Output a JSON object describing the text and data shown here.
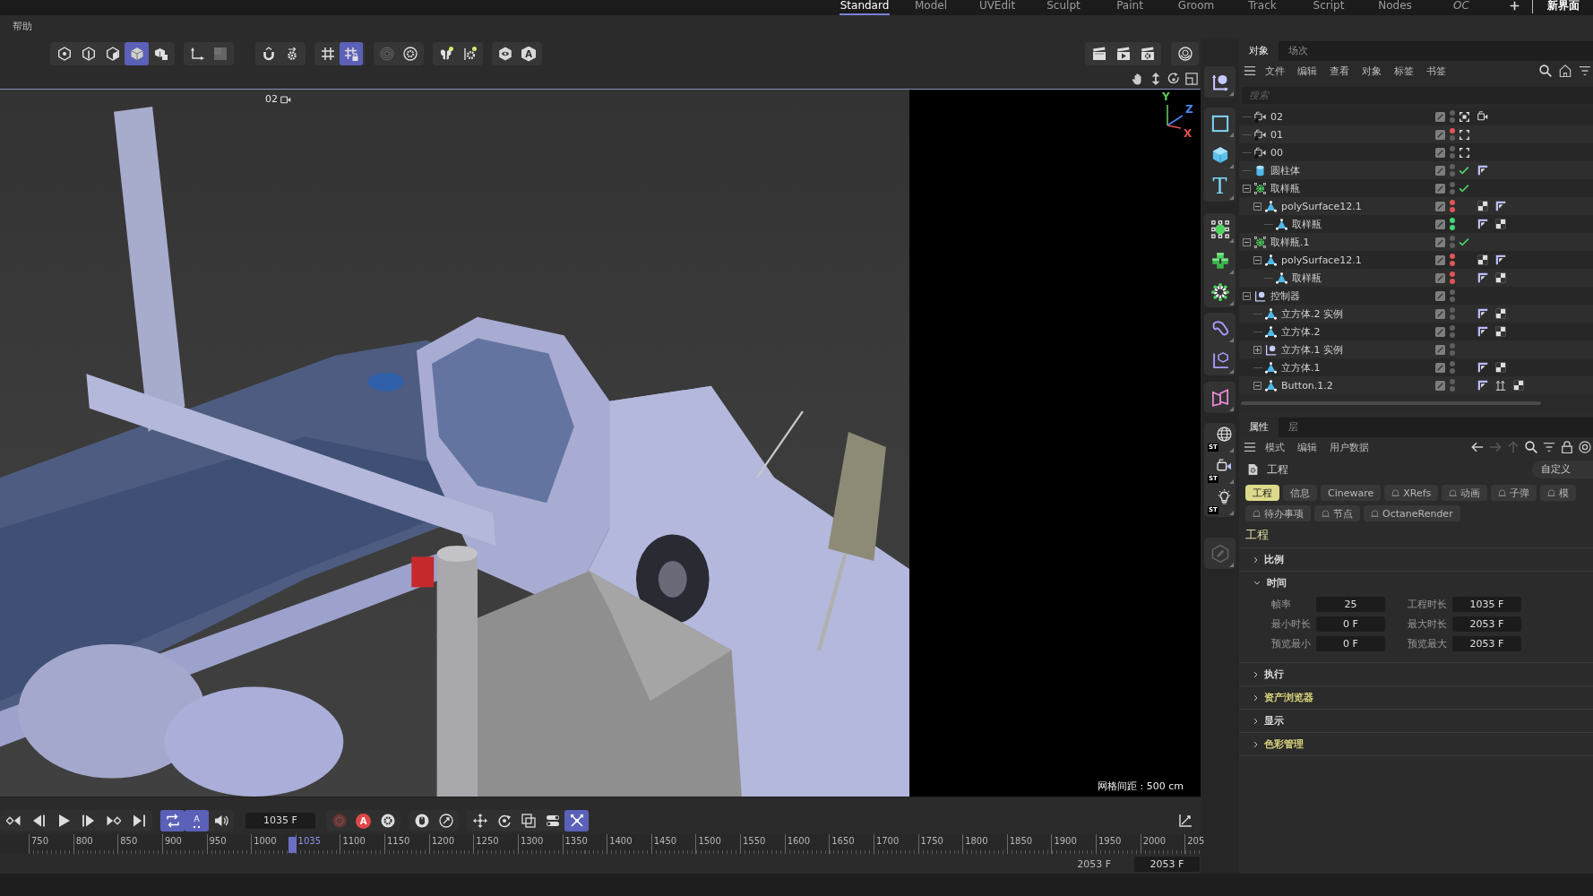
{
  "top_bar": {
    "layouts": [
      {
        "label": "Standard",
        "kind": "layout",
        "selected": true
      },
      {
        "label": "Model",
        "kind": "layout",
        "selected": false
      },
      {
        "label": "UVEdit",
        "kind": "layout",
        "selected": false
      },
      {
        "label": "Sculpt",
        "kind": "layout",
        "selected": false
      },
      {
        "label": "Paint",
        "kind": "layout",
        "selected": false
      },
      {
        "label": "Groom",
        "kind": "layout",
        "selected": false
      },
      {
        "label": "Track",
        "kind": "layout",
        "selected": false
      },
      {
        "label": "Script",
        "kind": "layout",
        "selected": false
      },
      {
        "label": "Nodes",
        "kind": "layout",
        "selected": false
      },
      {
        "label": "OC",
        "kind": "plugin",
        "selected": false
      }
    ],
    "new_layout": "新界面"
  },
  "menu_bar": [
    "帮助"
  ],
  "mode_toolbar": {
    "groups": [
      {
        "tools": [
          {
            "kind": "points",
            "selected": false,
            "disabled": false
          },
          {
            "kind": "edges",
            "selected": false,
            "disabled": false
          },
          {
            "kind": "polygons",
            "selected": false,
            "disabled": false
          },
          {
            "kind": "model",
            "selected": true,
            "disabled": false
          },
          {
            "kind": "uvw",
            "selected": false,
            "disabled": false
          }
        ]
      },
      {
        "tools": [
          {
            "kind": "axis",
            "selected": false,
            "disabled": false
          },
          {
            "kind": "solo",
            "selected": false,
            "disabled": true
          }
        ]
      },
      {
        "tools": [
          {
            "kind": "snap",
            "selected": false,
            "disabled": false
          },
          {
            "kind": "snap-settings",
            "selected": false,
            "disabled": false
          }
        ]
      },
      {
        "tools": [
          {
            "kind": "grid",
            "selected": false,
            "disabled": false
          },
          {
            "kind": "grid-lock",
            "selected": true,
            "disabled": false
          }
        ]
      },
      {
        "tools": [
          {
            "kind": "soft-select",
            "selected": false,
            "disabled": true
          },
          {
            "kind": "settings",
            "selected": false,
            "disabled": false
          }
        ]
      },
      {
        "tools": [
          {
            "kind": "symmetry",
            "selected": false,
            "disabled": false
          },
          {
            "kind": "symmetry-settings",
            "selected": false,
            "disabled": false
          }
        ]
      },
      {
        "tools": [
          {
            "kind": "view",
            "selected": false,
            "disabled": false
          },
          {
            "kind": "hex-label",
            "label": "A",
            "selected": false,
            "disabled": false
          }
        ]
      }
    ]
  },
  "viewport": {
    "camera_label": "02",
    "axes": [
      {
        "label": "Y",
        "color": "#5cc85c"
      },
      {
        "label": "Z",
        "color": "#4d86f0"
      },
      {
        "label": "X",
        "color": "#e25050"
      }
    ],
    "grid_spacing": "网格间距 : 500 cm"
  },
  "side_toolbar": {
    "groups": [
      {
        "tools": [
          {
            "kind": "null",
            "disabled": false
          }
        ]
      },
      {
        "tools": [
          {
            "kind": "spline-square",
            "disabled": false
          },
          {
            "kind": "cube",
            "disabled": false
          },
          {
            "kind": "text",
            "label": "T",
            "disabled": false
          }
        ]
      },
      {
        "tools": [
          {
            "kind": "generator",
            "disabled": false
          },
          {
            "kind": "cloner",
            "disabled": false
          },
          {
            "kind": "effector",
            "disabled": false
          }
        ]
      },
      {
        "tools": [
          {
            "kind": "deformer",
            "disabled": false
          },
          {
            "kind": "field",
            "disabled": false
          }
        ]
      },
      {
        "tools": [
          {
            "kind": "symmetry",
            "disabled": false
          }
        ]
      },
      {
        "tools": [
          {
            "kind": "globe",
            "badge": "ST",
            "disabled": false
          },
          {
            "kind": "camera",
            "badge": "ST",
            "disabled": false
          },
          {
            "kind": "light",
            "badge": "ST",
            "disabled": false
          }
        ]
      },
      {
        "tools": [
          {
            "kind": "pencil",
            "disabled": true
          }
        ]
      }
    ]
  },
  "object_manager": {
    "tabs": [
      {
        "label": "对象",
        "selected": true
      },
      {
        "label": "场次",
        "selected": false
      }
    ],
    "menu": [
      "文件",
      "编辑",
      "查看",
      "对象",
      "标签",
      "书签"
    ],
    "search": {
      "placeholder": "搜索"
    },
    "objects": [
      {
        "name": "02",
        "kind": "camera",
        "visibility": [
          {
            "color": "#5e5e5e"
          },
          {
            "color": "#5e5e5e"
          }
        ],
        "active": true,
        "tags": [
          {
            "kind": "camera"
          }
        ]
      },
      {
        "name": "01",
        "kind": "camera",
        "visibility": [
          {
            "color": "#e25555"
          },
          {
            "color": "#5e5e5e"
          }
        ],
        "active": false
      },
      {
        "name": "00",
        "kind": "camera",
        "visibility": [
          {
            "color": "#5e5e5e"
          },
          {
            "color": "#5e5e5e"
          }
        ],
        "active": false
      },
      {
        "name": "圆柱体",
        "kind": "cylinder",
        "visibility": [
          {
            "color": "#5e5e5e"
          },
          {
            "color": "#5e5e5e"
          }
        ],
        "enabled": true,
        "tags": [
          {
            "kind": "phong"
          }
        ]
      },
      {
        "name": "取样瓶",
        "kind": "cloner",
        "visibility": [
          {
            "color": "#5e5e5e"
          },
          {
            "color": "#5e5e5e"
          }
        ],
        "enabled": true,
        "expanded": true,
        "children": [
          {
            "name": "polySurface12.1",
            "kind": "polygon",
            "visibility": [
              {
                "color": "#e25555"
              },
              {
                "color": "#e25555"
              }
            ],
            "expanded": true,
            "tags": [
              {
                "kind": "material"
              },
              {
                "kind": "phong"
              }
            ],
            "children": [
              {
                "name": "取样瓶",
                "kind": "polygon",
                "visibility": [
                  {
                    "color": "#45d87a"
                  },
                  {
                    "color": "#45d87a"
                  }
                ],
                "tags": [
                  {
                    "kind": "phong"
                  },
                  {
                    "kind": "material"
                  }
                ]
              }
            ]
          }
        ]
      },
      {
        "name": "取样瓶.1",
        "kind": "cloner",
        "visibility": [
          {
            "color": "#5e5e5e"
          },
          {
            "color": "#5e5e5e"
          }
        ],
        "enabled": true,
        "expanded": true,
        "children": [
          {
            "name": "polySurface12.1",
            "kind": "polygon",
            "visibility": [
              {
                "color": "#e25555"
              },
              {
                "color": "#e25555"
              }
            ],
            "expanded": true,
            "tags": [
              {
                "kind": "material"
              },
              {
                "kind": "phong"
              }
            ],
            "children": [
              {
                "name": "取样瓶",
                "kind": "polygon",
                "visibility": [
                  {
                    "color": "#e25555"
                  },
                  {
                    "color": "#e25555"
                  }
                ],
                "tags": [
                  {
                    "kind": "phong"
                  },
                  {
                    "kind": "material"
                  }
                ]
              }
            ]
          }
        ]
      },
      {
        "name": "控制器",
        "kind": "null",
        "visibility": [
          {
            "color": "#5e5e5e"
          },
          {
            "color": "#5e5e5e"
          }
        ],
        "expanded": true,
        "children": [
          {
            "name": "立方体.2 实例",
            "kind": "polygon",
            "visibility": [
              {
                "color": "#5e5e5e"
              },
              {
                "color": "#5e5e5e"
              }
            ],
            "tags": [
              {
                "kind": "phong"
              },
              {
                "kind": "material"
              }
            ]
          },
          {
            "name": "立方体.2",
            "kind": "polygon",
            "visibility": [
              {
                "color": "#5e5e5e"
              },
              {
                "color": "#5e5e5e"
              }
            ],
            "tags": [
              {
                "kind": "phong"
              },
              {
                "kind": "material"
              }
            ]
          },
          {
            "name": "立方体.1 实例",
            "kind": "null",
            "visibility": [
              {
                "color": "#5e5e5e"
              },
              {
                "color": "#5e5e5e"
              }
            ],
            "expanded": false
          },
          {
            "name": "立方体.1",
            "kind": "polygon",
            "visibility": [
              {
                "color": "#5e5e5e"
              },
              {
                "color": "#5e5e5e"
              }
            ],
            "tags": [
              {
                "kind": "phong"
              },
              {
                "kind": "material"
              }
            ]
          },
          {
            "name": "Button.1.2",
            "kind": "polygon",
            "visibility": [
              {
                "color": "#5e5e5e"
              },
              {
                "color": "#5e5e5e"
              }
            ],
            "expanded": true,
            "tags": [
              {
                "kind": "phong"
              },
              {
                "kind": "constraint"
              },
              {
                "kind": "material"
              }
            ]
          }
        ]
      }
    ]
  },
  "attributes": {
    "tabs": [
      {
        "label": "属性",
        "selected": true
      },
      {
        "label": "层",
        "selected": false
      }
    ],
    "menu": [
      "模式",
      "编辑",
      "用户数据"
    ],
    "title": "工程",
    "preset": "自定义",
    "page_rows": [
      [
        {
          "label": "工程",
          "selected": true,
          "bell": false
        },
        {
          "label": "信息",
          "selected": false,
          "bell": false
        },
        {
          "label": "Cineware",
          "selected": false,
          "bell": false
        },
        {
          "label": "XRefs",
          "selected": false,
          "bell": true
        },
        {
          "label": "动画",
          "selected": false,
          "bell": true
        },
        {
          "label": "子弹",
          "selected": false,
          "bell": true
        },
        {
          "label": "模",
          "selected": false,
          "bell": true
        }
      ],
      [
        {
          "label": "待办事项",
          "selected": false,
          "bell": true
        },
        {
          "label": "节点",
          "selected": false,
          "bell": true
        },
        {
          "label": "OctaneRender",
          "selected": false,
          "bell": true
        }
      ]
    ],
    "section": "工程",
    "groups": [
      {
        "label": "比例",
        "expanded": false,
        "modified": false
      },
      {
        "label": "时间",
        "expanded": true,
        "modified": false,
        "fields": [
          {
            "label": "帧率",
            "value": "25"
          },
          {
            "label": "工程时长",
            "value": "1035 F"
          },
          {
            "label": "最小时长",
            "value": "0 F"
          },
          {
            "label": "最大时长",
            "value": "2053 F"
          },
          {
            "label": "预览最小",
            "value": "0 F"
          },
          {
            "label": "预览最大",
            "value": "2053 F"
          }
        ]
      },
      {
        "label": "执行",
        "expanded": false,
        "modified": false
      },
      {
        "label": "资产浏览器",
        "expanded": false,
        "modified": true
      },
      {
        "label": "显示",
        "expanded": false,
        "modified": false
      },
      {
        "label": "色彩管理",
        "expanded": false,
        "modified": true
      }
    ]
  },
  "timeline": {
    "left_groups": [
      {
        "tools": [
          {
            "kind": "prev-key",
            "selected": false,
            "disabled": false
          },
          {
            "kind": "prev-frame",
            "selected": false,
            "disabled": false
          },
          {
            "kind": "play",
            "selected": false,
            "disabled": false
          },
          {
            "kind": "next-frame",
            "selected": false,
            "disabled": false
          },
          {
            "kind": "next-key",
            "selected": false,
            "disabled": false
          },
          {
            "kind": "to-end",
            "selected": false,
            "disabled": false
          }
        ]
      },
      {
        "tools": [
          {
            "kind": "loop",
            "selected": true,
            "disabled": false
          },
          {
            "kind": "keys-track",
            "label": "A",
            "selected": true,
            "disabled": false
          },
          {
            "kind": "sound",
            "selected": false,
            "disabled": false
          }
        ]
      }
    ],
    "frame": "1035 F",
    "right_groups": [
      {
        "tools": [
          {
            "kind": "record",
            "selected": false,
            "disabled": true
          },
          {
            "kind": "autokey",
            "label": "A",
            "selected": false,
            "disabled": false
          },
          {
            "kind": "key-settings",
            "selected": false,
            "disabled": false
          }
        ]
      },
      {
        "tools": [
          {
            "kind": "mouse",
            "selected": false,
            "disabled": false
          },
          {
            "kind": "motion",
            "selected": false,
            "disabled": false
          }
        ]
      },
      {
        "tools": [
          {
            "kind": "move",
            "selected": false,
            "disabled": false
          },
          {
            "kind": "rotate",
            "selected": false,
            "disabled": false
          },
          {
            "kind": "scale",
            "selected": false,
            "disabled": false
          },
          {
            "kind": "toggle",
            "selected": false,
            "disabled": false
          },
          {
            "kind": "cross",
            "selected": true,
            "disabled": false
          }
        ]
      }
    ],
    "ruler": {
      "labels_before": [
        "750",
        "800",
        "850",
        "900",
        "950",
        "1000"
      ],
      "labels_after": [
        "1100",
        "1150",
        "1200",
        "1250",
        "1300",
        "1350",
        "1400",
        "1450",
        "1500",
        "1550",
        "1600",
        "1650",
        "1700",
        "1750",
        "1800",
        "1850",
        "1900",
        "1950",
        "2000",
        "205"
      ],
      "playhead": {
        "label": "1035",
        "level": 0.24
      }
    },
    "preview_end": "2053 F",
    "end_field": "2053 F"
  }
}
